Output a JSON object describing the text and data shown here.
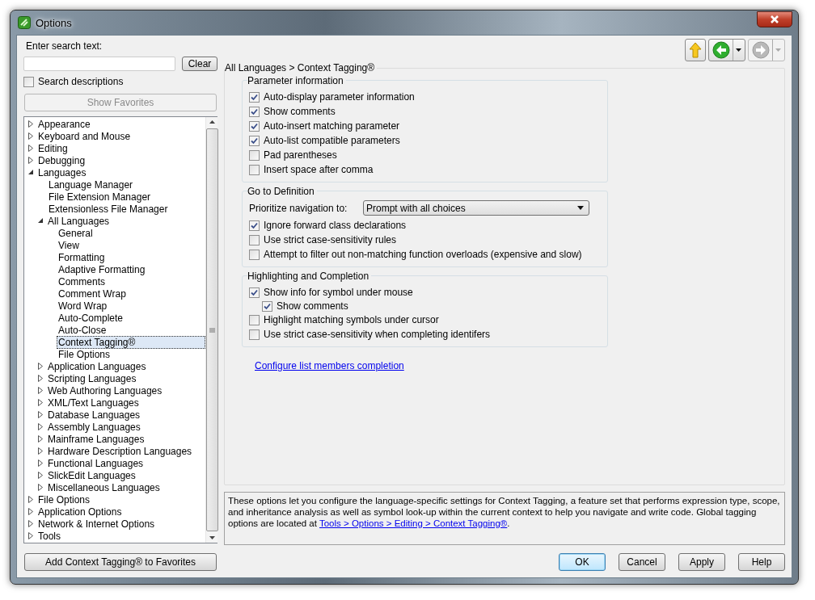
{
  "window": {
    "title": "Options"
  },
  "search": {
    "label": "Enter search text:",
    "clear_button": "Clear",
    "descriptions_checkbox": {
      "label": "Search descriptions",
      "checked": false
    }
  },
  "show_favorites": {
    "label": "Show Favorites",
    "disabled": true
  },
  "tree": [
    {
      "label": "Appearance",
      "kind": "folder",
      "expanded": false,
      "selected": false
    },
    {
      "label": "Keyboard and Mouse",
      "kind": "folder",
      "expanded": false,
      "selected": false
    },
    {
      "label": "Editing",
      "kind": "folder",
      "expanded": false,
      "selected": false
    },
    {
      "label": "Debugging",
      "kind": "folder",
      "expanded": false,
      "selected": false
    },
    {
      "label": "Languages",
      "kind": "folder",
      "expanded": true,
      "selected": false,
      "children": [
        {
          "label": "Language Manager",
          "kind": "leaf",
          "selected": false
        },
        {
          "label": "File Extension Manager",
          "kind": "leaf",
          "selected": false
        },
        {
          "label": "Extensionless File Manager",
          "kind": "leaf",
          "selected": false
        },
        {
          "label": "All Languages",
          "kind": "folder",
          "expanded": true,
          "selected": false,
          "children": [
            {
              "label": "General",
              "kind": "leaf",
              "selected": false
            },
            {
              "label": "View",
              "kind": "leaf",
              "selected": false
            },
            {
              "label": "Formatting",
              "kind": "leaf",
              "selected": false
            },
            {
              "label": "Adaptive Formatting",
              "kind": "leaf",
              "selected": false
            },
            {
              "label": "Comments",
              "kind": "leaf",
              "selected": false
            },
            {
              "label": "Comment Wrap",
              "kind": "leaf",
              "selected": false
            },
            {
              "label": "Word Wrap",
              "kind": "leaf",
              "selected": false
            },
            {
              "label": "Auto-Complete",
              "kind": "leaf",
              "selected": false
            },
            {
              "label": "Auto-Close",
              "kind": "leaf",
              "selected": false
            },
            {
              "label": "Context Tagging®",
              "kind": "leaf",
              "selected": true
            },
            {
              "label": "File Options",
              "kind": "leaf",
              "selected": false
            }
          ]
        },
        {
          "label": "Application Languages",
          "kind": "folder",
          "expanded": false,
          "selected": false
        },
        {
          "label": "Scripting Languages",
          "kind": "folder",
          "expanded": false,
          "selected": false
        },
        {
          "label": "Web Authoring Languages",
          "kind": "folder",
          "expanded": false,
          "selected": false
        },
        {
          "label": "XML/Text Languages",
          "kind": "folder",
          "expanded": false,
          "selected": false
        },
        {
          "label": "Database Languages",
          "kind": "folder",
          "expanded": false,
          "selected": false
        },
        {
          "label": "Assembly Languages",
          "kind": "folder",
          "expanded": false,
          "selected": false
        },
        {
          "label": "Mainframe Languages",
          "kind": "folder",
          "expanded": false,
          "selected": false
        },
        {
          "label": "Hardware Description Languages",
          "kind": "folder",
          "expanded": false,
          "selected": false
        },
        {
          "label": "Functional Languages",
          "kind": "folder",
          "expanded": false,
          "selected": false
        },
        {
          "label": "SlickEdit Languages",
          "kind": "folder",
          "expanded": false,
          "selected": false
        },
        {
          "label": "Miscellaneous Languages",
          "kind": "folder",
          "expanded": false,
          "selected": false
        }
      ]
    },
    {
      "label": "File Options",
      "kind": "folder",
      "expanded": false,
      "selected": false
    },
    {
      "label": "Application Options",
      "kind": "folder",
      "expanded": false,
      "selected": false
    },
    {
      "label": "Network & Internet Options",
      "kind": "folder",
      "expanded": false,
      "selected": false
    },
    {
      "label": "Tools",
      "kind": "folder",
      "expanded": false,
      "selected": false
    }
  ],
  "add_favorites_button": "Add Context Tagging® to Favorites",
  "nav_buttons": [
    {
      "kind": "up",
      "disabled": false
    },
    {
      "kind": "back",
      "disabled": false
    },
    {
      "kind": "forward",
      "disabled": true
    }
  ],
  "breadcrumb": "All Languages > Context Tagging®",
  "groups": [
    {
      "title": "Parameter information",
      "options": [
        {
          "label": "Auto-display parameter information",
          "checked": true
        },
        {
          "label": "Show comments",
          "checked": true
        },
        {
          "label": "Auto-insert matching parameter",
          "checked": true
        },
        {
          "label": "Auto-list compatible parameters",
          "checked": true
        },
        {
          "label": "Pad parentheses",
          "checked": false
        },
        {
          "label": "Insert space after comma",
          "checked": false
        }
      ]
    },
    {
      "title": "Go to Definition",
      "dropdown": {
        "label": "Prioritize navigation to:",
        "value": "Prompt with all choices"
      },
      "options": [
        {
          "label": "Ignore forward class declarations",
          "checked": true
        },
        {
          "label": "Use strict case-sensitivity rules",
          "checked": false
        },
        {
          "label": "Attempt to filter out non-matching function overloads (expensive and slow)",
          "checked": false
        }
      ]
    },
    {
      "title": "Highlighting and Completion",
      "options": [
        {
          "label": "Show info for symbol under mouse",
          "checked": true,
          "children": [
            {
              "label": "Show comments",
              "checked": true
            }
          ]
        },
        {
          "label": "Highlight matching symbols under cursor",
          "checked": false
        },
        {
          "label": "Use strict case-sensitivity when completing identifers",
          "checked": false
        }
      ]
    }
  ],
  "config_link": "Configure list members completion",
  "description": {
    "text": "These options let you configure the language-specific settings for Context Tagging, a feature set that performs expression type, scope, and inheritance analysis as well as symbol look-up within the current context to help you navigate and write code. Global tagging options are located at",
    "link": "Tools > Options > Editing > Context Tagging®",
    "tail": "."
  },
  "buttons": [
    {
      "label": "OK",
      "default": true
    },
    {
      "label": "Cancel",
      "default": false
    },
    {
      "label": "Apply",
      "default": false
    },
    {
      "label": "Help",
      "default": false
    }
  ]
}
